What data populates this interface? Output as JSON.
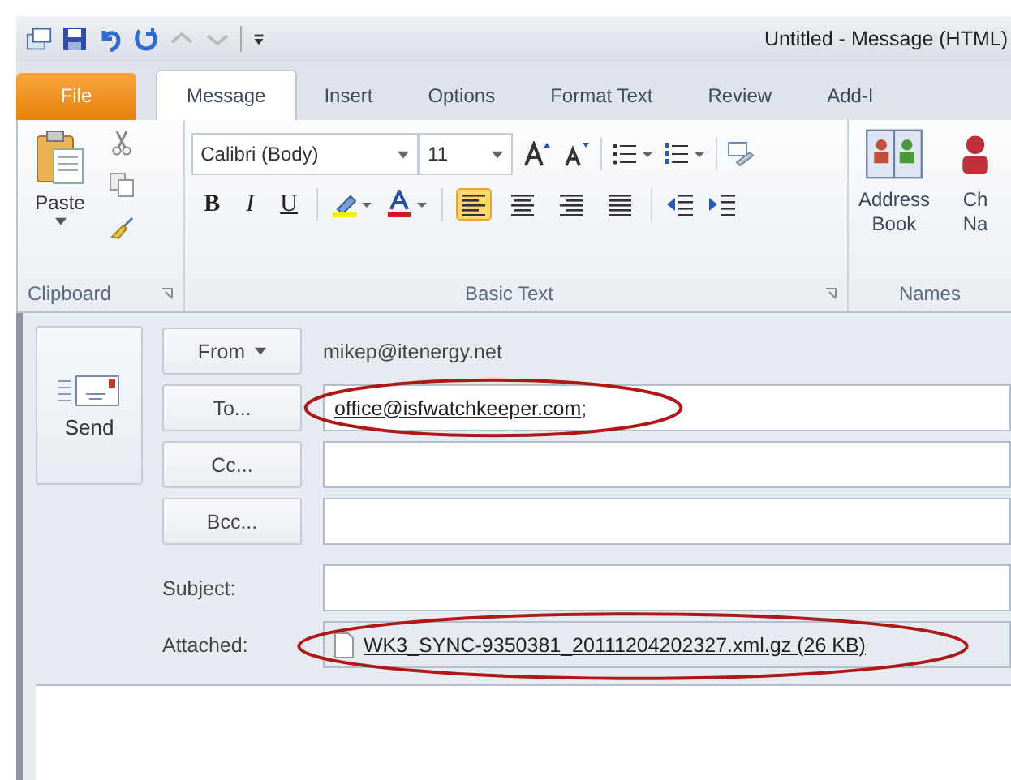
{
  "window": {
    "title": "Untitled  -  Message (HTML)"
  },
  "tabs": [
    {
      "label": "File",
      "kind": "file",
      "selected": false
    },
    {
      "label": "Message",
      "kind": "tab",
      "selected": true
    },
    {
      "label": "Insert",
      "kind": "tab",
      "selected": false
    },
    {
      "label": "Options",
      "kind": "tab",
      "selected": false
    },
    {
      "label": "Format Text",
      "kind": "tab",
      "selected": false
    },
    {
      "label": "Review",
      "kind": "tab",
      "selected": false
    },
    {
      "label": "Add-I",
      "kind": "tab",
      "selected": false
    }
  ],
  "ribbon": {
    "clipboard": {
      "paste_label": "Paste",
      "group_label": "Clipboard"
    },
    "basic_text": {
      "font": "Calibri (Body)",
      "size": "11",
      "format_buttons": [
        "B",
        "I",
        "U"
      ],
      "alignments": [
        {
          "selected": true
        },
        {
          "selected": false
        },
        {
          "selected": false
        },
        {
          "selected": false
        }
      ],
      "group_label": "Basic Text"
    },
    "names": {
      "buttons": [
        {
          "lines": [
            "Address",
            "Book"
          ]
        },
        {
          "lines": [
            "Ch",
            "Na"
          ]
        }
      ],
      "group_label": "Names"
    }
  },
  "send_label": "Send",
  "fields": [
    {
      "kind": "dropdown",
      "label": "From",
      "value": "mikep@itenergy.net",
      "annotated": false
    },
    {
      "kind": "recipient",
      "label": "To...",
      "value": "office@isfwatchkeeper.com",
      "suffix": ";",
      "annotated": true
    },
    {
      "kind": "recipient",
      "label": "Cc...",
      "annotated": false
    },
    {
      "kind": "recipient",
      "label": "Bcc...",
      "annotated": false
    },
    {
      "kind": "text",
      "label": "Subject:",
      "annotated": false
    },
    {
      "kind": "attachment",
      "label": "Attached:",
      "value": "WK3_SYNC-9350381_20111204202327.xml.gz (26 KB)",
      "annotated": true
    }
  ]
}
